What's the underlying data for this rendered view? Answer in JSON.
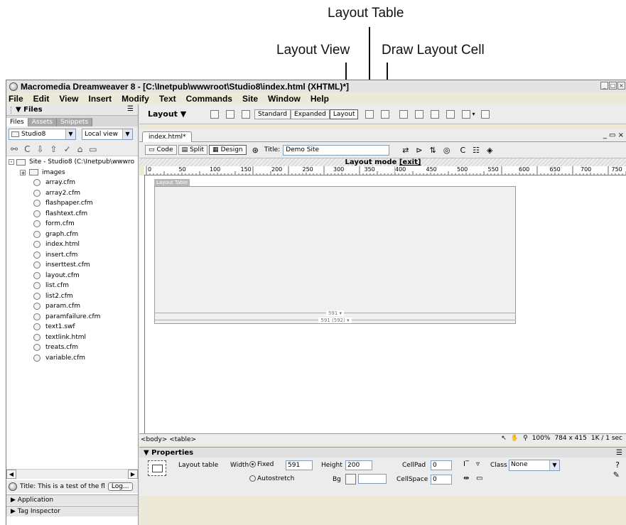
{
  "callouts": {
    "layout_table": "Layout Table",
    "layout_view": "Layout View",
    "draw_layout_cell": "Draw Layout Cell"
  },
  "window": {
    "title": "Macromedia Dreamweaver 8 - [C:\\Inetpub\\wwwroot\\Studio8\\index.html (XHTML)*]"
  },
  "menu": [
    "File",
    "Edit",
    "View",
    "Insert",
    "Modify",
    "Text",
    "Commands",
    "Site",
    "Window",
    "Help"
  ],
  "files_panel": {
    "header": "▼ Files",
    "tabs": [
      "Files",
      "Assets",
      "Snippets"
    ],
    "site_select": "Studio8",
    "view_select": "Local view",
    "root": "Site - Studio8 (C:\\Inetpub\\wwwro",
    "folder": "images",
    "files": [
      "array.cfm",
      "array2.cfm",
      "flashpaper.cfm",
      "flashtext.cfm",
      "form.cfm",
      "graph.cfm",
      "index.html",
      "insert.cfm",
      "inserttest.cfm",
      "layout.cfm",
      "list.cfm",
      "list2.cfm",
      "param.cfm",
      "paramfailure.cfm",
      "text1.swf",
      "textlink.html",
      "treats.cfm",
      "variable.cfm"
    ],
    "status_title": "Title: This is a test of the fl",
    "log_button": "Log...",
    "application": "▶ Application",
    "tag_inspector": "▶ Tag Inspector"
  },
  "insert_bar": {
    "category": "Layout ▼",
    "standard": "Standard",
    "expanded": "Expanded",
    "layout": "Layout"
  },
  "document": {
    "tab": "index.html*",
    "code": "Code",
    "split": "Split",
    "design": "Design",
    "title_label": "Title:",
    "title_value": "Demo Site",
    "layout_mode": "Layout mode",
    "exit": "[exit]",
    "ruler_marks": [
      "0",
      "50",
      "100",
      "150",
      "200",
      "250",
      "300",
      "350",
      "400",
      "450",
      "500",
      "550",
      "600",
      "650",
      "700",
      "750"
    ],
    "layout_table_tab": "Layout Table",
    "col_width_1": "591 ▾",
    "col_width_2": "591 (592) ▾"
  },
  "status_bar": {
    "tags": "<body> <table>",
    "zoom": "100%",
    "size": "784 x 415",
    "download": "1K / 1 sec"
  },
  "properties": {
    "header": "▼ Properties",
    "type_label": "Layout table",
    "width_label": "Width",
    "fixed_label": "Fixed",
    "width_value": "591",
    "autostretch_label": "Autostretch",
    "height_label": "Height",
    "height_value": "200",
    "bg_label": "Bg",
    "cellpad_label": "CellPad",
    "cellpad_value": "0",
    "cellspace_label": "CellSpace",
    "cellspace_value": "0",
    "class_label": "Class",
    "class_value": "None"
  }
}
